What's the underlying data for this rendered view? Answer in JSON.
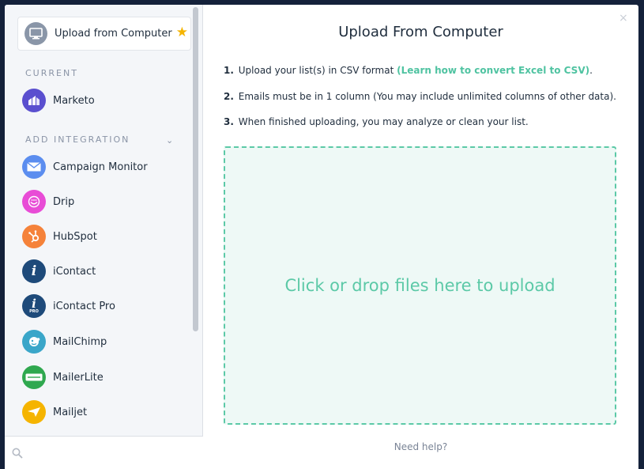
{
  "sidebar": {
    "selected": {
      "label": "Upload from Computer",
      "icon": "monitor-icon",
      "star_icon": "star-icon"
    },
    "current_label": "CURRENT",
    "current_items": [
      {
        "label": "Marketo",
        "icon": "marketo-icon",
        "color": "#5a4fcf"
      }
    ],
    "add_label": "ADD INTEGRATION",
    "integrations": [
      {
        "label": "Campaign Monitor",
        "icon": "envelope-icon",
        "color": "#5b8def"
      },
      {
        "label": "Drip",
        "icon": "drip-icon",
        "color": "#e84cd6"
      },
      {
        "label": "HubSpot",
        "icon": "hubspot-icon",
        "color": "#f5823a"
      },
      {
        "label": "iContact",
        "icon": "icontact-icon",
        "color": "#1e4a7a"
      },
      {
        "label": "iContact Pro",
        "icon": "icontact-pro-icon",
        "color": "#1e4a7a"
      },
      {
        "label": "MailChimp",
        "icon": "mailchimp-icon",
        "color": "#3aa6c9"
      },
      {
        "label": "MailerLite",
        "icon": "mailerlite-icon",
        "color": "#2fa84f"
      },
      {
        "label": "Mailjet",
        "icon": "mailjet-icon",
        "color": "#f5b400"
      }
    ],
    "search": {
      "placeholder": ""
    }
  },
  "main": {
    "title": "Upload From Computer",
    "steps": [
      {
        "num": "1.",
        "text": "Upload your list(s) in CSV format ",
        "link": "(Learn how to convert Excel to CSV)",
        "suffix": "."
      },
      {
        "num": "2.",
        "text": "Emails must be in 1 column (You may include unlimited columns of other data).",
        "link": "",
        "suffix": ""
      },
      {
        "num": "3.",
        "text": "When finished uploading, you may analyze or clean your list.",
        "link": "",
        "suffix": ""
      }
    ],
    "dropzone_text": "Click or drop files here to upload",
    "help_text": "Need help?",
    "close_symbol": "×"
  },
  "colors": {
    "accent": "#5cc9a7",
    "accent_bg": "#eef9f6",
    "star": "#f5b400"
  }
}
